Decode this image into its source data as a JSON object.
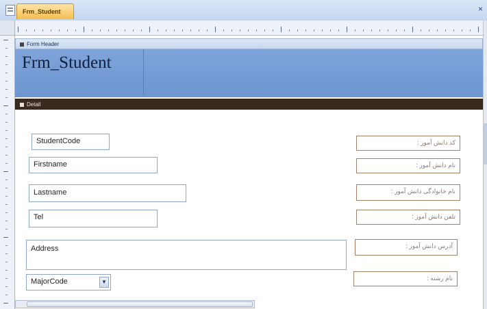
{
  "tab": {
    "label": "Frm_Student"
  },
  "window": {
    "close_glyph": "×"
  },
  "sections": {
    "header": "Form Header",
    "detail": "Detail"
  },
  "form": {
    "title": "Frm_Student"
  },
  "fields": {
    "student_code": "StudentCode",
    "firstname": "Firstname",
    "lastname": "Lastname",
    "tel": "Tel",
    "address": "Address",
    "major_code": "MajorCode"
  },
  "labels": {
    "student_code": "کد دانش آموز :",
    "firstname": "نام دانش آموز :",
    "lastname": "نام خانوادگی دانش آموز :",
    "tel": "تلفن دانش آموز :",
    "address": "آدرس دانش آموز :",
    "major_code": "نام رشته :"
  },
  "icons": {
    "document": "form-document-icon",
    "close": "close-icon",
    "combo_arrow": "chevron-down-icon"
  },
  "colors": {
    "header_fill": "#7ea4da",
    "detail_bar": "#3b2b1f",
    "active_tab": "#f5bd4f"
  }
}
